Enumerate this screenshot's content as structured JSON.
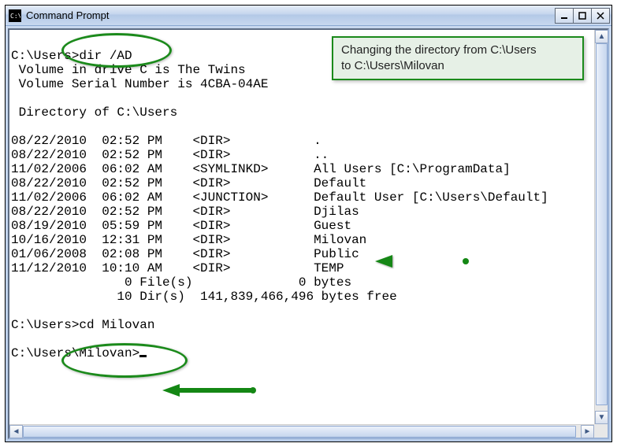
{
  "window": {
    "title": "Command Prompt",
    "buttons": {
      "min": "_",
      "max": "□",
      "close": "✕"
    }
  },
  "callout": {
    "line1": "Changing the directory from C:\\Users",
    "line2": "to C:\\Users\\Milovan"
  },
  "console": {
    "prompt1_path": "C:\\Users>",
    "cmd1": "dir /AD",
    "vol_line": " Volume in drive C is The Twins",
    "serial_line": " Volume Serial Number is 4CBA-04AE",
    "dir_of": " Directory of C:\\Users",
    "rows": [
      {
        "date": "08/22/2010",
        "time": "02:52 PM",
        "type": "<DIR>",
        "name": "."
      },
      {
        "date": "08/22/2010",
        "time": "02:52 PM",
        "type": "<DIR>",
        "name": ".."
      },
      {
        "date": "11/02/2006",
        "time": "06:02 AM",
        "type": "<SYMLINKD>",
        "name": "All Users [C:\\ProgramData]"
      },
      {
        "date": "08/22/2010",
        "time": "02:52 PM",
        "type": "<DIR>",
        "name": "Default"
      },
      {
        "date": "11/02/2006",
        "time": "06:02 AM",
        "type": "<JUNCTION>",
        "name": "Default User [C:\\Users\\Default]"
      },
      {
        "date": "08/22/2010",
        "time": "02:52 PM",
        "type": "<DIR>",
        "name": "Djilas"
      },
      {
        "date": "08/19/2010",
        "time": "05:59 PM",
        "type": "<DIR>",
        "name": "Guest"
      },
      {
        "date": "10/16/2010",
        "time": "12:31 PM",
        "type": "<DIR>",
        "name": "Milovan"
      },
      {
        "date": "01/06/2008",
        "time": "02:08 PM",
        "type": "<DIR>",
        "name": "Public"
      },
      {
        "date": "11/12/2010",
        "time": "10:10 AM",
        "type": "<DIR>",
        "name": "TEMP"
      }
    ],
    "summary_files": "               0 File(s)              0 bytes",
    "summary_dirs": "              10 Dir(s)  141,839,466,496 bytes free",
    "prompt2_path": "C:\\Users>",
    "cmd2": "cd Milovan",
    "prompt3_path": "C:\\Users\\Milovan>"
  },
  "annotations": {
    "ellipse1": "highlight-dir-command",
    "ellipse2": "highlight-cd-command",
    "arrow1": "arrow-to-milovan-entry",
    "arrow2": "arrow-to-new-prompt"
  }
}
